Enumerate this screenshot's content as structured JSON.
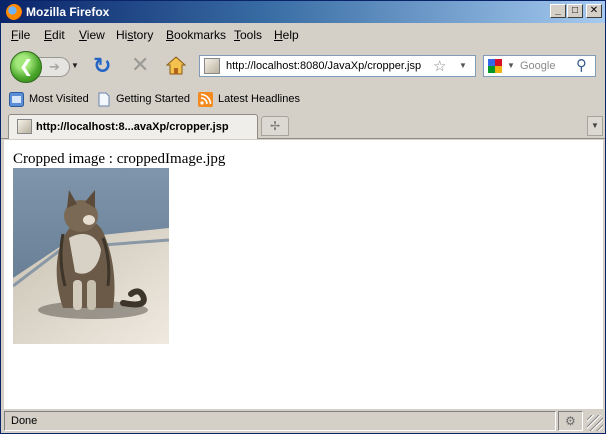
{
  "window": {
    "title": "Mozilla Firefox"
  },
  "menu": [
    {
      "label": "File",
      "accel": "F"
    },
    {
      "label": "Edit",
      "accel": "E"
    },
    {
      "label": "View",
      "accel": "V"
    },
    {
      "label": "History",
      "accel": "s"
    },
    {
      "label": "Bookmarks",
      "accel": "B"
    },
    {
      "label": "Tools",
      "accel": "T"
    },
    {
      "label": "Help",
      "accel": "H"
    }
  ],
  "navbar": {
    "url": "http://localhost:8080/JavaXp/cropper.jsp",
    "search_placeholder": "Google"
  },
  "bookmarks": [
    {
      "label": "Most Visited",
      "icon": "most-visited-icon"
    },
    {
      "label": "Getting Started",
      "icon": "page-icon"
    },
    {
      "label": "Latest Headlines",
      "icon": "rss-feed-icon"
    }
  ],
  "tabs": [
    {
      "title": "http://localhost:8...avaXp/cropper.jsp",
      "active": true
    }
  ],
  "content": {
    "caption": "Cropped image : croppedImage.jpg"
  },
  "status": {
    "text": "Done"
  }
}
